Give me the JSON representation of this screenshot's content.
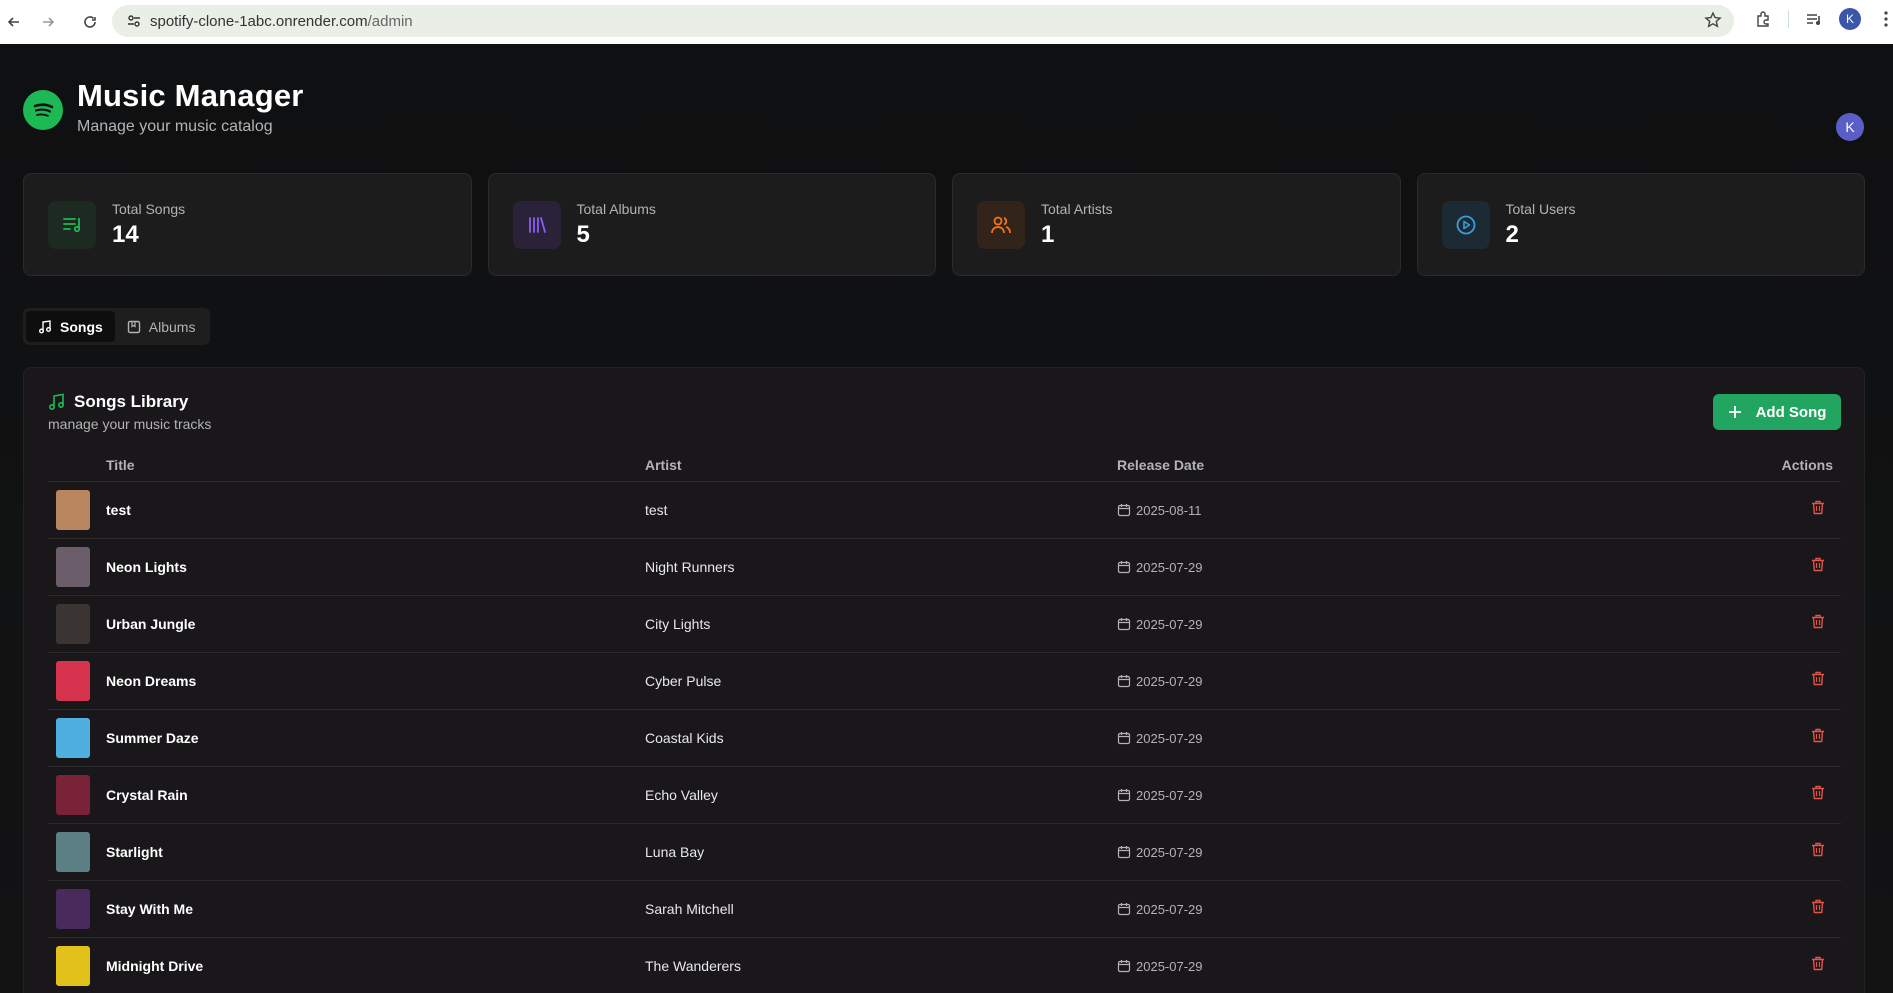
{
  "browser": {
    "url_host": "spotify-clone-1abc.onrender.com",
    "url_path": "/admin",
    "profile_initial": "K"
  },
  "app": {
    "title": "Music Manager",
    "subtitle": "Manage your music catalog",
    "user_initial": "K"
  },
  "stats": [
    {
      "label": "Total Songs",
      "value": "14",
      "icon": "list-music-icon",
      "color": "#1db954"
    },
    {
      "label": "Total Albums",
      "value": "5",
      "icon": "library-icon",
      "color": "#8b5cf6"
    },
    {
      "label": "Total Artists",
      "value": "1",
      "icon": "users-icon",
      "color": "#f97316"
    },
    {
      "label": "Total Users",
      "value": "2",
      "icon": "play-circle-icon",
      "color": "#3b9ddd"
    }
  ],
  "tabs": [
    {
      "label": "Songs",
      "icon": "music-icon",
      "active": true
    },
    {
      "label": "Albums",
      "icon": "album-icon",
      "active": false
    }
  ],
  "library": {
    "title": "Songs Library",
    "subtitle": "manage your music tracks",
    "add_label": "Add Song",
    "columns": {
      "title": "Title",
      "artist": "Artist",
      "release": "Release Date",
      "actions": "Actions"
    },
    "rows": [
      {
        "title": "test",
        "artist": "test",
        "date": "2025-08-11",
        "thumb": "#b98660"
      },
      {
        "title": "Neon Lights",
        "artist": "Night Runners",
        "date": "2025-07-29",
        "thumb": "#6b5d6a"
      },
      {
        "title": "Urban Jungle",
        "artist": "City Lights",
        "date": "2025-07-29",
        "thumb": "#3a3533"
      },
      {
        "title": "Neon Dreams",
        "artist": "Cyber Pulse",
        "date": "2025-07-29",
        "thumb": "#d6334f"
      },
      {
        "title": "Summer Daze",
        "artist": "Coastal Kids",
        "date": "2025-07-29",
        "thumb": "#4fb0e0"
      },
      {
        "title": "Crystal Rain",
        "artist": "Echo Valley",
        "date": "2025-07-29",
        "thumb": "#7a2238"
      },
      {
        "title": "Starlight",
        "artist": "Luna Bay",
        "date": "2025-07-29",
        "thumb": "#5b7f85"
      },
      {
        "title": "Stay With Me",
        "artist": "Sarah Mitchell",
        "date": "2025-07-29",
        "thumb": "#4a2a5c"
      },
      {
        "title": "Midnight Drive",
        "artist": "The Wanderers",
        "date": "2025-07-29",
        "thumb": "#e2c21a"
      }
    ]
  }
}
